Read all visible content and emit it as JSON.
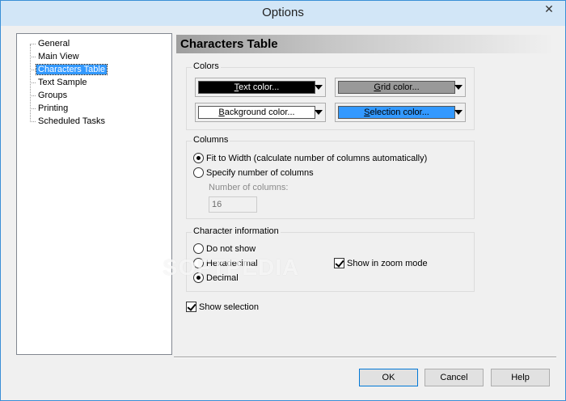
{
  "window": {
    "title": "Options",
    "close_glyph": "✕"
  },
  "tree": {
    "items": [
      {
        "label": "General"
      },
      {
        "label": "Main View"
      },
      {
        "label": "Characters Table",
        "selected": true
      },
      {
        "label": "Text Sample"
      },
      {
        "label": "Groups"
      },
      {
        "label": "Printing"
      },
      {
        "label": "Scheduled Tasks"
      }
    ]
  },
  "page": {
    "header": "Characters Table",
    "colors": {
      "legend": "Colors",
      "text_color": {
        "label_u": "T",
        "label_rest": "ext color...",
        "swatch": "#000000",
        "fg": "#ffffff"
      },
      "grid_color": {
        "label_u": "G",
        "label_rest": "rid color...",
        "swatch": "#999999",
        "fg": "#000000"
      },
      "background_color": {
        "label_u": "B",
        "label_rest": "ackground color...",
        "swatch": "#ffffff",
        "fg": "#000000"
      },
      "selection_color": {
        "label_u": "S",
        "label_rest": "election color...",
        "swatch": "#3399ff",
        "fg": "#000000"
      }
    },
    "columns": {
      "legend": "Columns",
      "fit_to_width": "Fit to Width (calculate number of columns automatically)",
      "specify_number": "Specify number of columns",
      "number_label": "Number of columns:",
      "number_value": "16"
    },
    "char_info": {
      "legend": "Character information",
      "do_not_show": "Do not show",
      "hexadecimal": "Hexadecimal",
      "decimal": "Decimal",
      "show_zoom": "Show in zoom mode"
    },
    "show_selection": "Show selection"
  },
  "buttons": {
    "ok": "OK",
    "cancel": "Cancel",
    "help": "Help"
  },
  "watermark": "SOFTPEDIA"
}
